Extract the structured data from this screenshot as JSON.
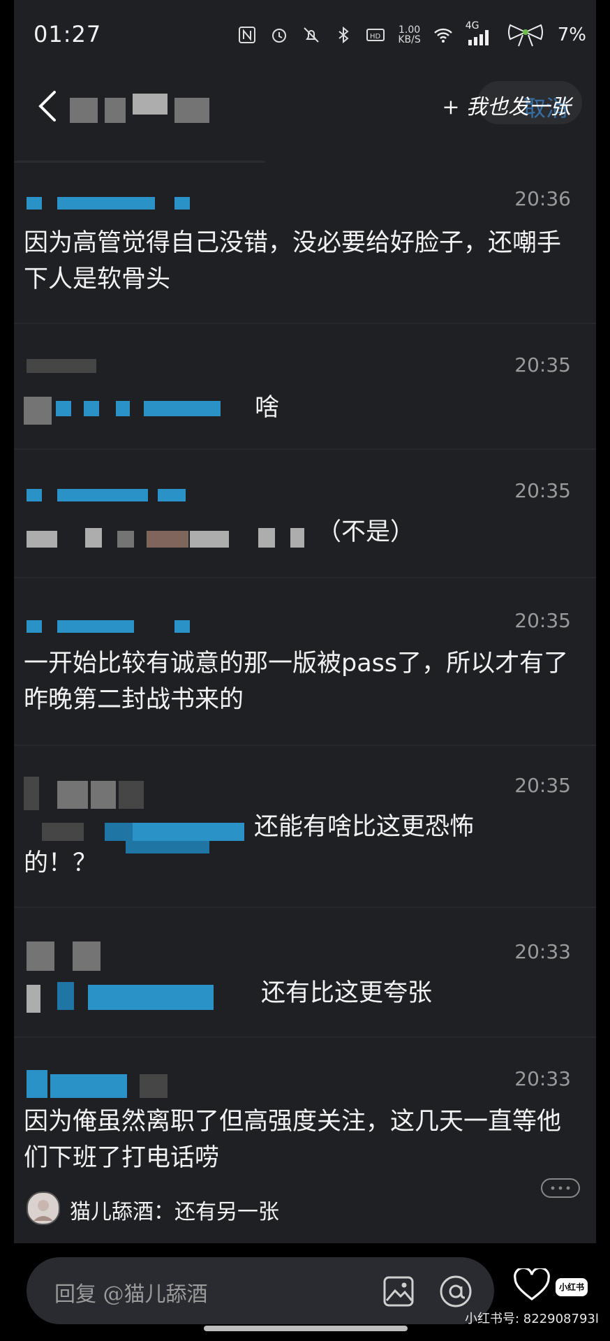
{
  "status_bar": {
    "time": "01:27",
    "net_speed_value": "1.00",
    "net_speed_unit": "KB/S",
    "network_type": "4G",
    "battery": "7%"
  },
  "header": {
    "back_icon": "chevron-left-icon",
    "cancel_label": "取消",
    "post_label": "+ 我也发一张"
  },
  "comments": [
    {
      "time": "20:36",
      "text": "因为高管觉得自己没错，没必要给好脸子，还嘲手下人是软骨头"
    },
    {
      "time": "20:35",
      "text": "啥"
    },
    {
      "time": "20:35",
      "text": "（不是）"
    },
    {
      "time": "20:35",
      "text": "一开始比较有诚意的那一版被pass了，所以才有了昨晚第二封战书来的"
    },
    {
      "time": "20:35",
      "text": "还能有啥比这更恐怖",
      "text2": "的！？"
    },
    {
      "time": "20:33",
      "text": "还有比这更夸张"
    },
    {
      "time": "20:33",
      "text": "因为俺虽然离职了但高强度关注，这几天一直等他们下班了打电话唠"
    }
  ],
  "quote": {
    "text": "猫儿舔酒：还有另一张"
  },
  "bottom": {
    "reply_placeholder": "回复 @猫儿舔酒",
    "logo_text": "小红书",
    "xhs_id": "小红书号: 822908793l"
  }
}
